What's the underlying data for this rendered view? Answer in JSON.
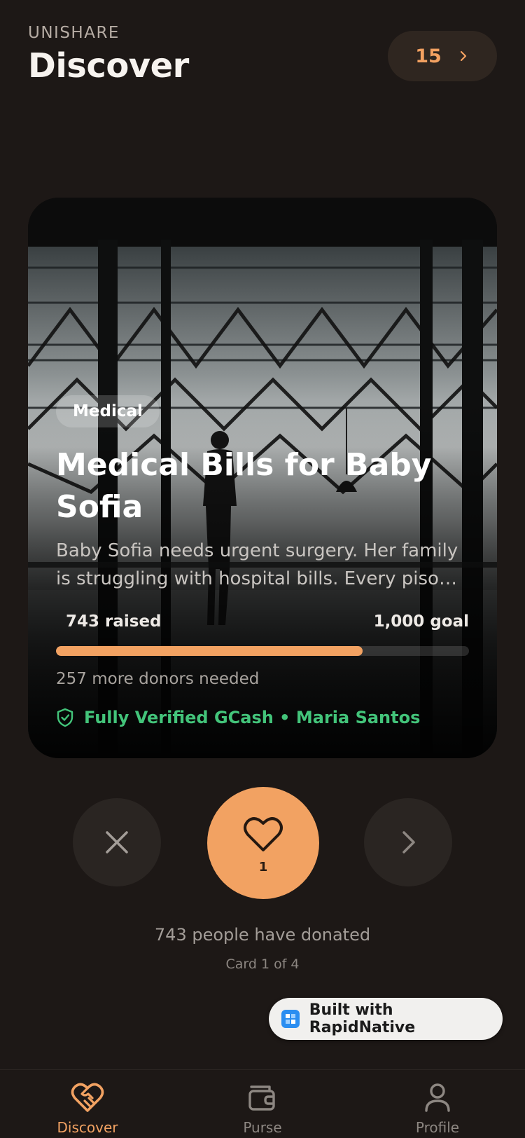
{
  "header": {
    "brand": "UNISHARE",
    "title": "Discover",
    "count": "15"
  },
  "card": {
    "category": "Medical",
    "title": "Medical Bills for Baby Sofia",
    "description": "Baby Sofia needs urgent surgery. Her family is struggling with hospital bills. Every piso counts.",
    "raised_label": "743 raised",
    "goal_label": "1,000 goal",
    "raised": 743,
    "goal": 1000,
    "donors_needed": "257 more donors needed",
    "verified_text": "Fully Verified GCash • Maria Santos"
  },
  "actions": {
    "like_count": "1"
  },
  "summary": {
    "donated_text": "743 people have donated",
    "card_index": "Card 1 of 4"
  },
  "badge": {
    "text": "Built with RapidNative"
  },
  "tabs": [
    {
      "label": "Discover",
      "icon": "heart-handshake-icon",
      "active": true
    },
    {
      "label": "Purse",
      "icon": "wallet-icon",
      "active": false
    },
    {
      "label": "Profile",
      "icon": "user-icon",
      "active": false
    }
  ],
  "colors": {
    "accent": "#f2a262",
    "verified": "#43c47a",
    "background": "#1d1816"
  }
}
